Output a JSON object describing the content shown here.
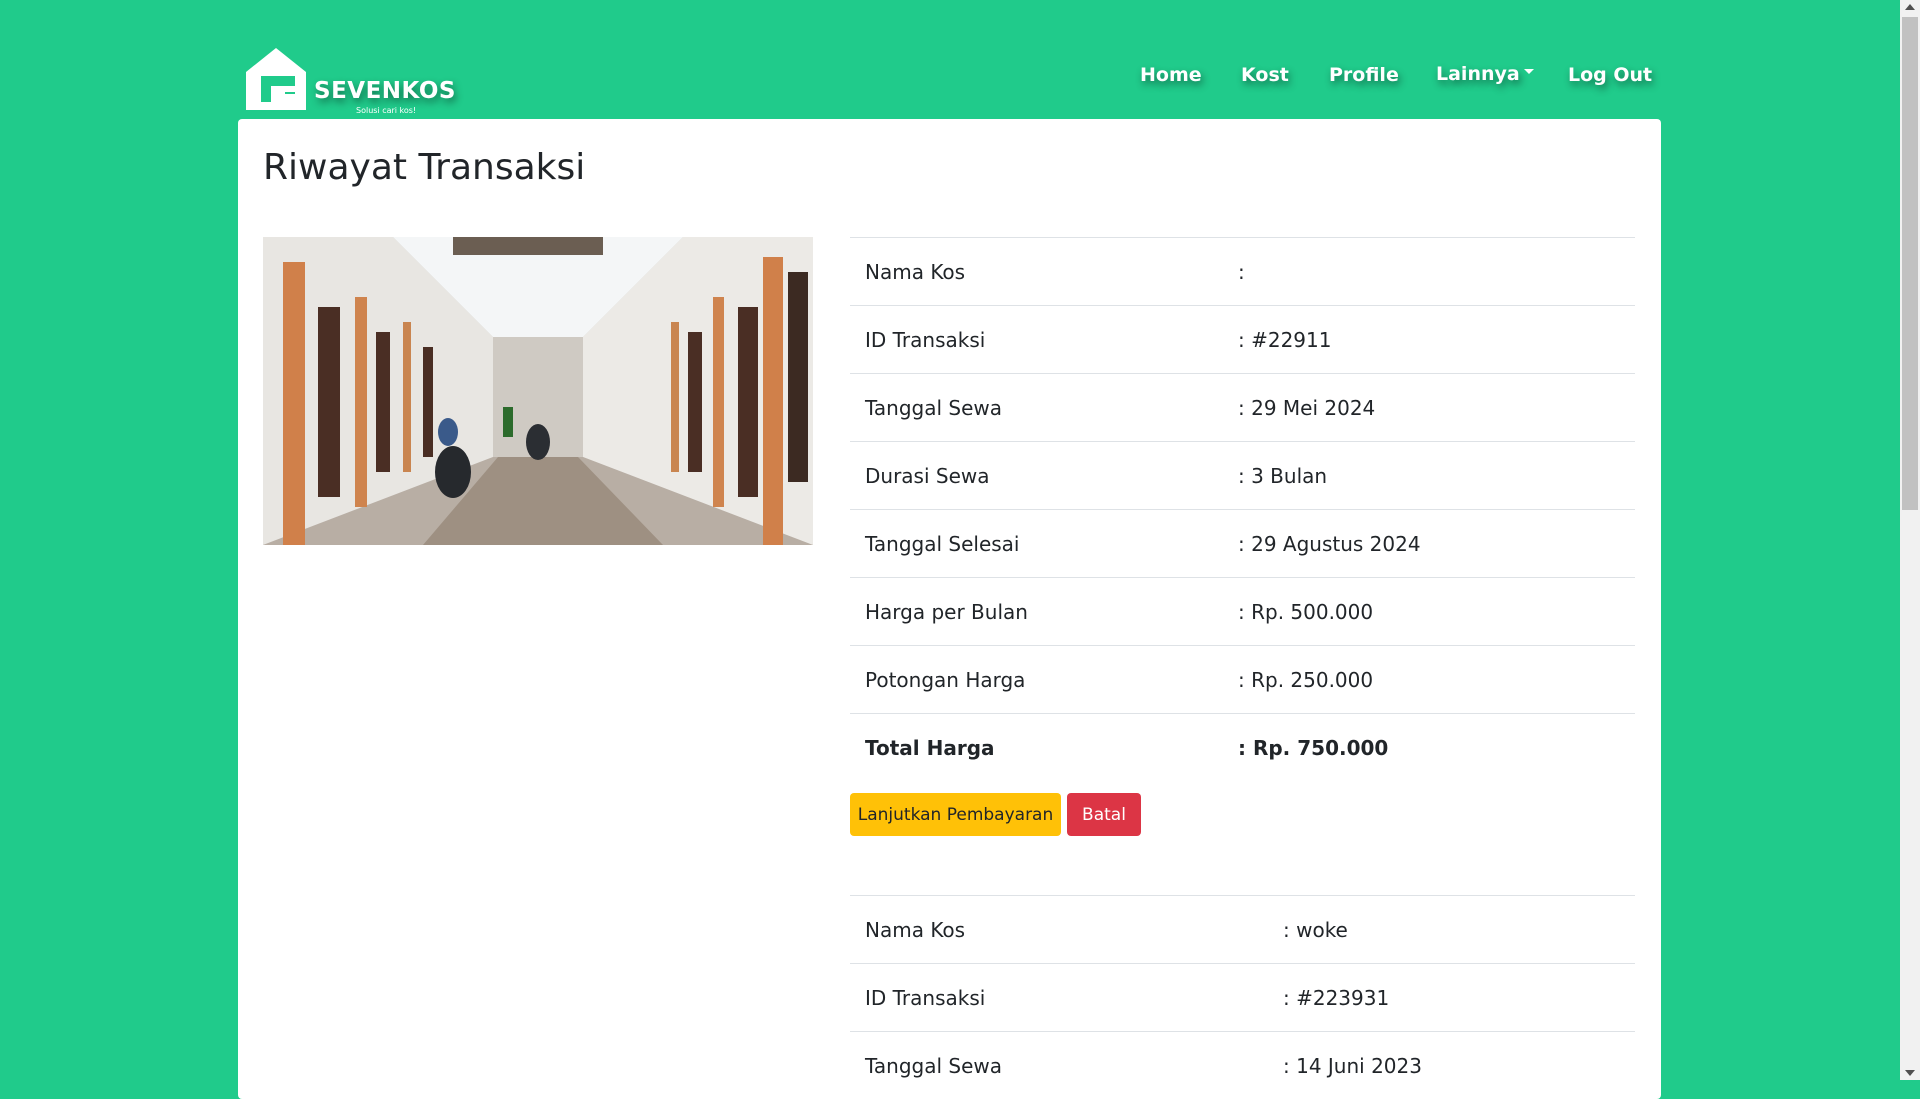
{
  "brand": {
    "name": "SEVENKOS",
    "tagline": "Solusi cari kos!"
  },
  "nav": [
    {
      "label": "Home"
    },
    {
      "label": "Kost"
    },
    {
      "label": "Profile"
    },
    {
      "label": "Lainnya"
    },
    {
      "label": "Log Out"
    }
  ],
  "page": {
    "title": "Riwayat Transaksi"
  },
  "transactions": [
    {
      "rows": [
        {
          "label": "Nama Kos",
          "value": ":"
        },
        {
          "label": "ID Transaksi",
          "value": ": #22911"
        },
        {
          "label": "Tanggal Sewa",
          "value": ": 29 Mei 2024"
        },
        {
          "label": "Durasi Sewa",
          "value": ": 3 Bulan"
        },
        {
          "label": "Tanggal Selesai",
          "value": ": 29 Agustus 2024"
        },
        {
          "label": "Harga per Bulan",
          "value": ": Rp. 500.000"
        },
        {
          "label": "Potongan Harga",
          "value": ": Rp. 250.000"
        },
        {
          "label": "Total Harga",
          "value": ": Rp. 750.000"
        }
      ],
      "actions": {
        "pay": "Lanjutkan Pembayaran",
        "cancel": "Batal"
      }
    },
    {
      "rows": [
        {
          "label": "Nama Kos",
          "value": ": woke"
        },
        {
          "label": "ID Transaksi",
          "value": ": #223931"
        },
        {
          "label": "Tanggal Sewa",
          "value": ": 14 Juni 2023"
        }
      ]
    }
  ],
  "colors": {
    "background": "#20cb8b",
    "warning": "#ffc107",
    "danger": "#dc3545"
  }
}
